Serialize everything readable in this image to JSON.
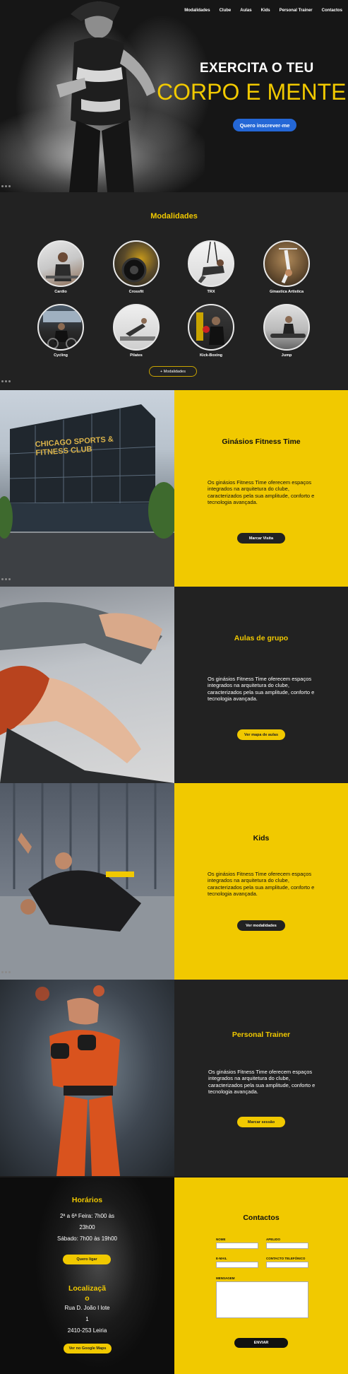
{
  "nav": [
    "Modalidades",
    "Clube",
    "Aulas",
    "Kids",
    "Personal Trainer",
    "Contactos"
  ],
  "hero": {
    "line1": "EXERCITA O TEU",
    "line2": "CORPO E MENTE",
    "cta": "Quero inscrever-me"
  },
  "modalidades": {
    "title": "Modalidades",
    "items": [
      "Cardio",
      "Crossfit",
      "TRX",
      "Ginastica Artistica",
      "Cycling",
      "Pilates",
      "Kick-Boxing",
      "Jump"
    ],
    "more": "+ Modalidades"
  },
  "sections": [
    {
      "title": "Ginásios Fitness Time",
      "text": "Os ginásios Fitness Time oferecem espaços integrados na arquitetura do clube, caracterizados pela sua amplitude, conforto e tecnologia avançada.",
      "cta": "Marcar Visita",
      "photo_sign": "CHICAGO SPORTS & FITNESS CLUB"
    },
    {
      "title": "Aulas de grupo",
      "text": "Os ginásios Fitness Time oferecem espaços integrados na arquitetura do clube, caracterizados pela sua amplitude, conforto e tecnologia avançada.",
      "cta": "Ver mapa  de aulas"
    },
    {
      "title": "Kids",
      "text": "Os ginásios Fitness Time oferecem espaços integrados na arquitetura do clube, caracterizados pela sua amplitude, conforto e tecnologia avançada.",
      "cta": "Ver modalidades"
    },
    {
      "title": "Personal Trainer",
      "text": "Os ginásios Fitness Time oferecem espaços integrados na arquitetura do clube, caracterizados pela sua amplitude, conforto e tecnologia avançada.",
      "cta": "Marcar sessão"
    }
  ],
  "horarios": {
    "title": "Horários",
    "line1": "2ª a 6ª Feira: 7h00 às",
    "line2": "23h00",
    "line3": "Sábado: 7h00 às 19h00",
    "cta": "Quero ligar"
  },
  "localizacao": {
    "title": "Localizaçã",
    "title2": "o",
    "line1": "Rua D. João I lote",
    "line2": "1",
    "line3": "2410-253 Leiria",
    "cta": "Ver no Google Maps"
  },
  "contactos": {
    "title": "Contactos",
    "nome": "NOME",
    "apelido": "APELIDO",
    "email": "E-MAIL",
    "telefone": "CONTACTO TELEFÓNICO",
    "mensagem": "MENSAGEM",
    "send": "ENVIAR"
  },
  "colors": {
    "accent": "#f1c900",
    "dark": "#222222",
    "hero_button": "#2467d6"
  }
}
